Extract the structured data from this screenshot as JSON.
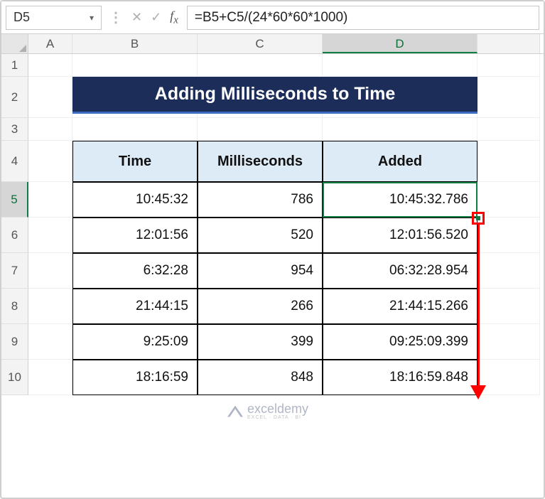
{
  "name_box": "D5",
  "formula": "=B5+C5/(24*60*60*1000)",
  "columns": [
    "A",
    "B",
    "C",
    "D"
  ],
  "active_col": "D",
  "active_row": "5",
  "row_numbers": [
    "1",
    "2",
    "3",
    "4",
    "5",
    "6",
    "7",
    "8",
    "9",
    "10"
  ],
  "title": "Adding Milliseconds to Time",
  "headers": {
    "c1": "Time",
    "c2": "Milliseconds",
    "c3": "Added"
  },
  "rows": [
    {
      "time": "10:45:32",
      "ms": "786",
      "added": "10:45:32.786"
    },
    {
      "time": "12:01:56",
      "ms": "520",
      "added": "12:01:56.520"
    },
    {
      "time": "6:32:28",
      "ms": "954",
      "added": "06:32:28.954"
    },
    {
      "time": "21:44:15",
      "ms": "266",
      "added": "21:44:15.266"
    },
    {
      "time": "9:25:09",
      "ms": "399",
      "added": "09:25:09.399"
    },
    {
      "time": "18:16:59",
      "ms": "848",
      "added": "18:16:59.848"
    }
  ],
  "watermark": {
    "brand": "exceldemy",
    "tag": "EXCEL · DATA · BI"
  }
}
